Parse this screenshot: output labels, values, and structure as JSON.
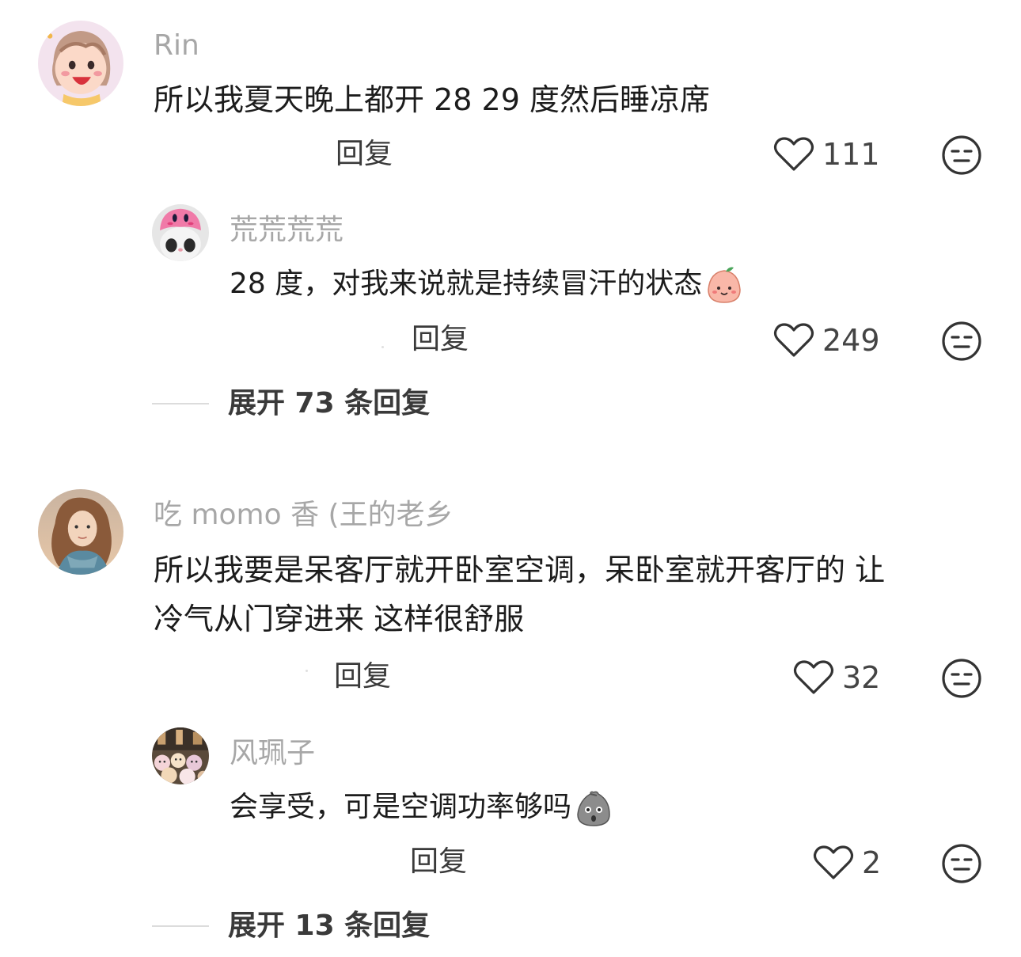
{
  "comments": [
    {
      "username": "Rin",
      "text": "所以我夏天晚上都开 28 29 度然后睡凉席",
      "reply_label": "回复",
      "likes": "111",
      "avatar_icon": "cartoon-girl-avatar",
      "replies": [
        {
          "username": "荒荒荒荒",
          "text": "28 度，对我来说就是持续冒汗的状态",
          "emoji": "peach-face-emoji",
          "reply_label": "回复",
          "likes": "249",
          "avatar_icon": "kirby-cat-avatar"
        }
      ],
      "expand_label": "展开 73 条回复"
    },
    {
      "username": "吃 momo 香 (王的老乡",
      "text_line1": "所以我要是呆客厅就开卧室空调，呆卧室就开客厅的 让",
      "text_line2": "冷气从门穿进来 这样很舒服",
      "reply_label": "回复",
      "likes": "32",
      "avatar_icon": "woman-portrait-avatar",
      "replies": [
        {
          "username": "风珮子",
          "text": "会享受，可是空调功率够吗",
          "emoji": "shocked-bag-emoji",
          "reply_label": "回复",
          "likes": "2",
          "avatar_icon": "plush-toys-avatar"
        }
      ],
      "expand_label": "展开 13 条回复"
    }
  ],
  "colors": {
    "username": "#a7a7a7",
    "text": "#1c1c1c",
    "action": "#3a3a3a",
    "background": "#ffffff"
  }
}
